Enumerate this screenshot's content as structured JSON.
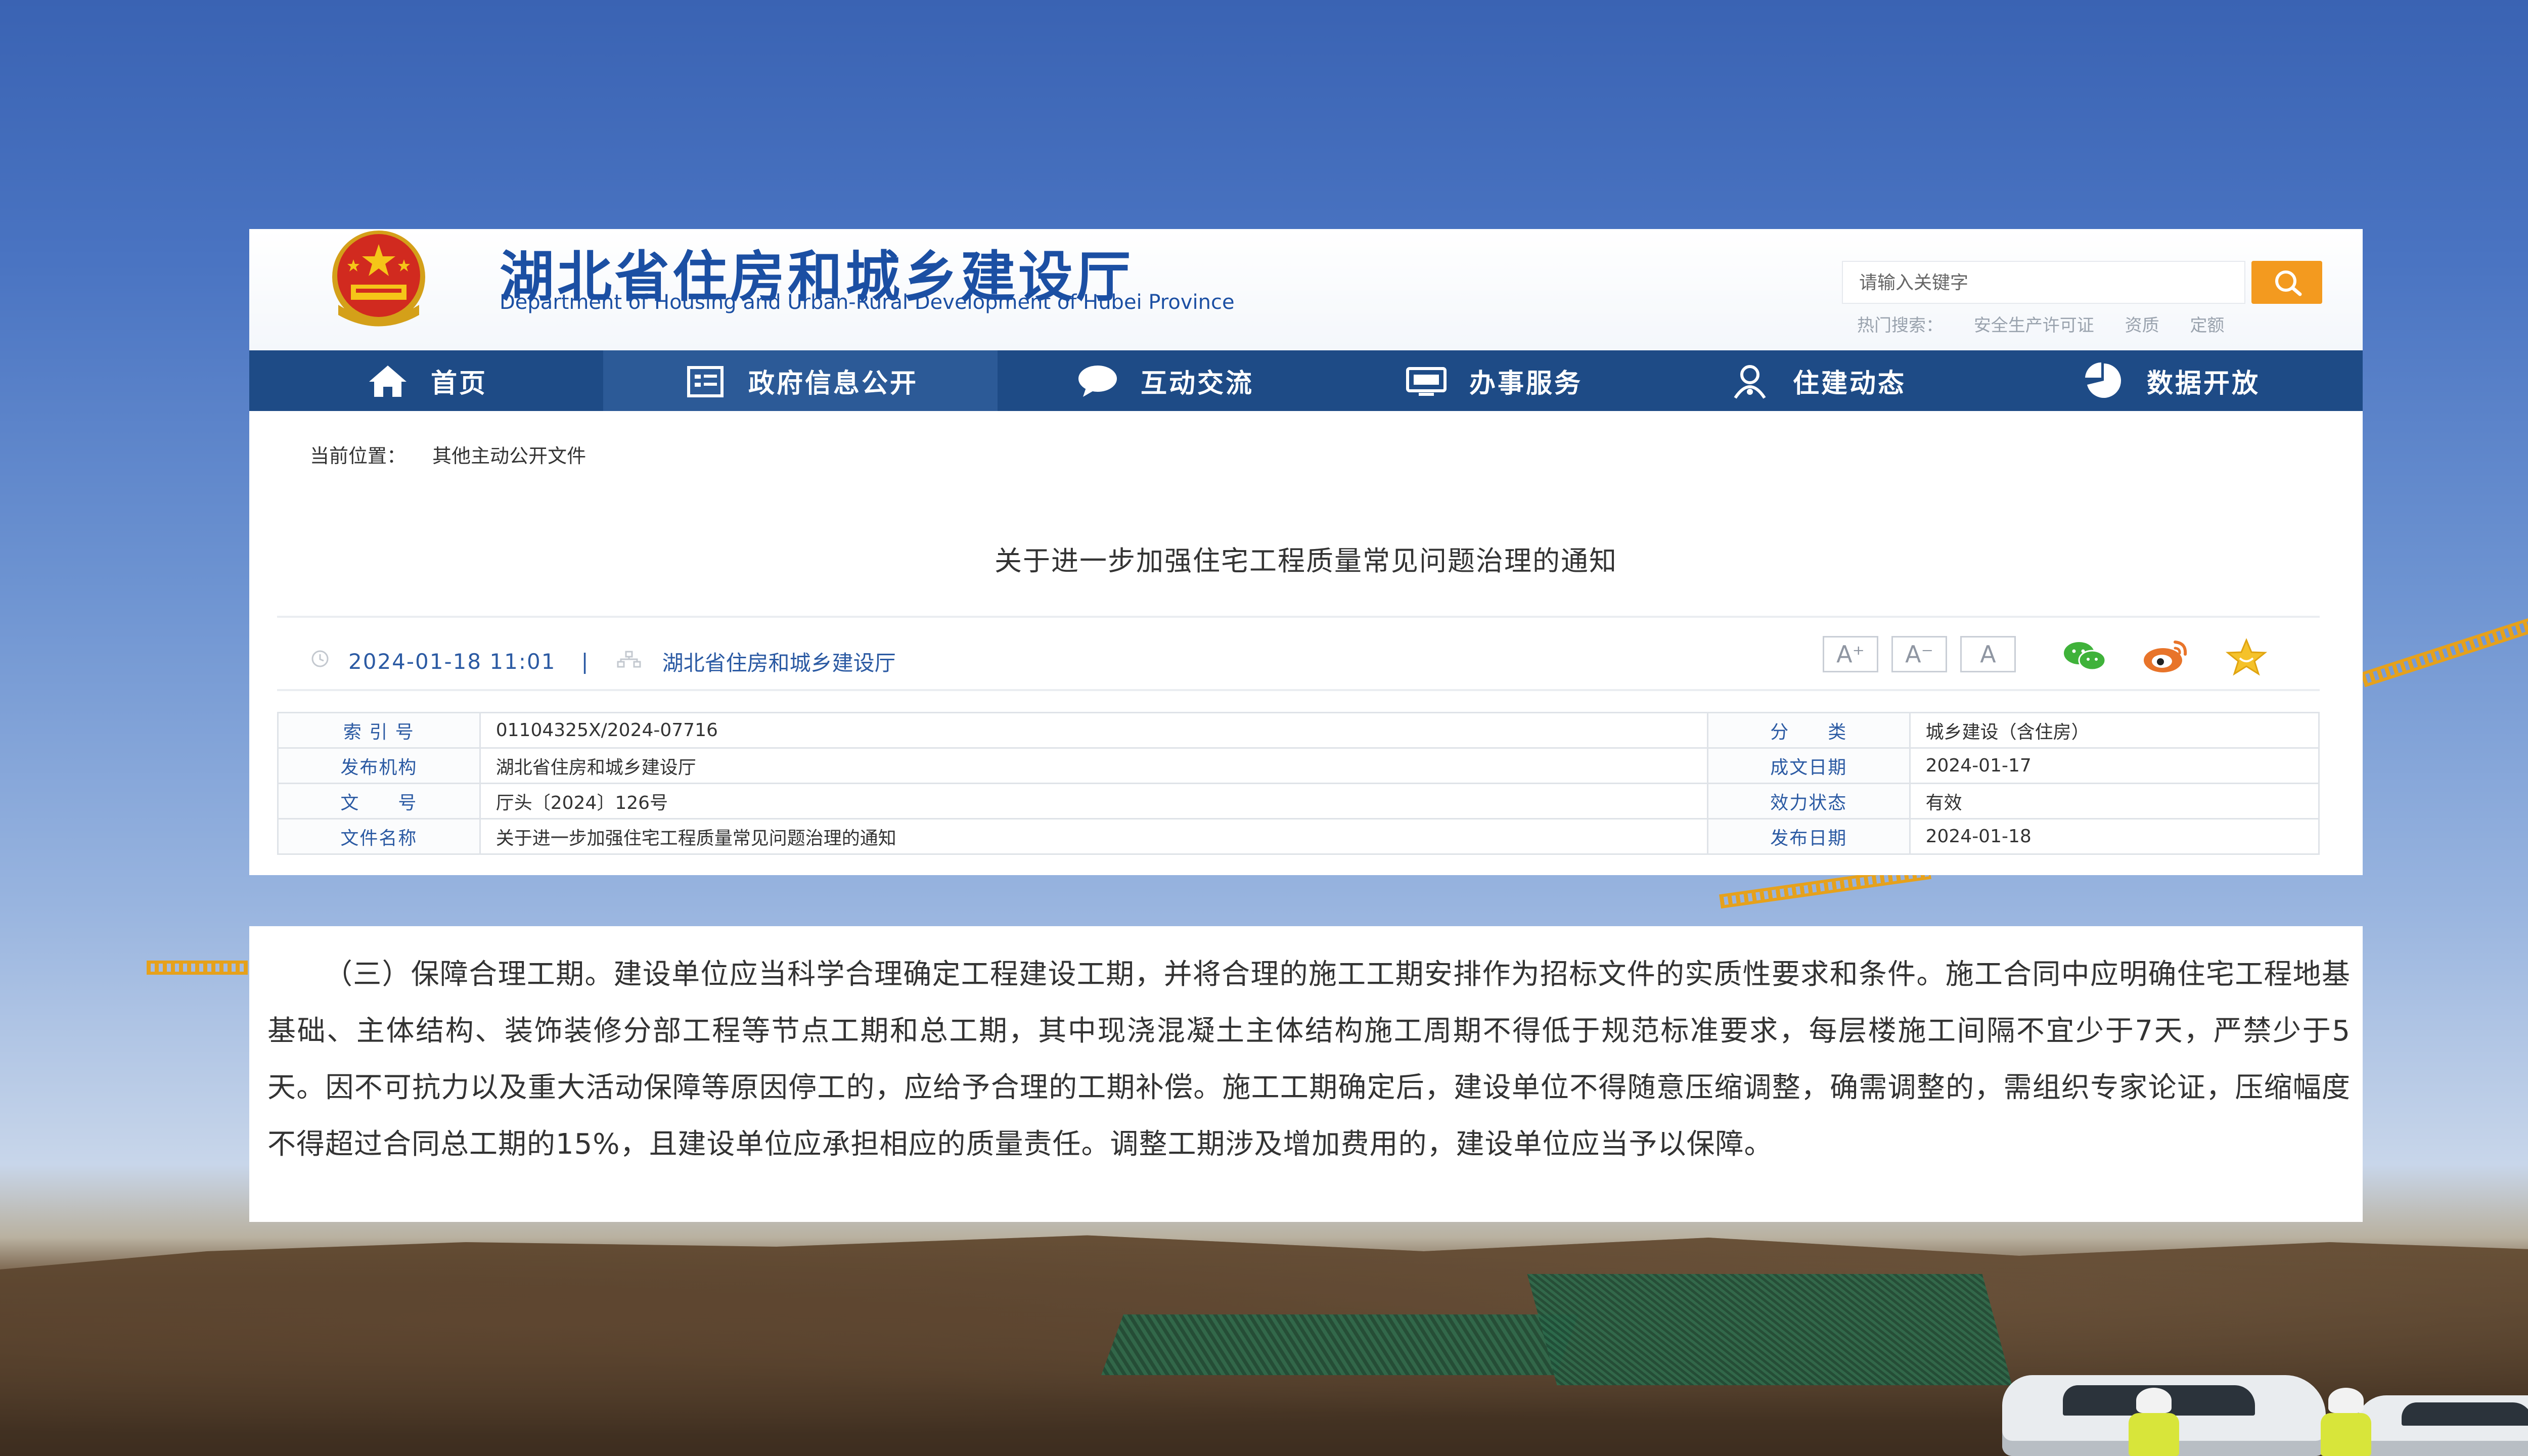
{
  "header": {
    "site_title": "湖北省住房和城乡建设厅",
    "site_subtitle": "Department of Housing and Urban-Rural Development of Hubei Province",
    "search_placeholder": "请输入关键字",
    "hot_search_label": "热门搜索：",
    "hot_search_items": [
      "安全生产许可证",
      "资质",
      "定额"
    ]
  },
  "nav": {
    "items": [
      {
        "label": "首页",
        "icon": "home-icon"
      },
      {
        "label": "政府信息公开",
        "icon": "document-list-icon",
        "active": true
      },
      {
        "label": "互动交流",
        "icon": "chat-bubble-icon"
      },
      {
        "label": "办事服务",
        "icon": "monitor-icon"
      },
      {
        "label": "住建动态",
        "icon": "user-icon"
      },
      {
        "label": "数据开放",
        "icon": "pie-chart-icon"
      }
    ]
  },
  "breadcrumb": {
    "label": "当前位置：",
    "current": "其他主动公开文件"
  },
  "article": {
    "title": "关于进一步加强住宅工程质量常见问题治理的通知",
    "date": "2024-01-18 11:01",
    "separator": "|",
    "publisher": "湖北省住房和城乡建设厅"
  },
  "font_size_buttons": [
    "A⁺",
    "A⁻",
    "A"
  ],
  "share_icons": [
    "wechat-icon",
    "weibo-icon",
    "favorite-star-icon"
  ],
  "info_table": [
    [
      {
        "label": "索 引 号",
        "value": "01104325X/2024-07716"
      },
      {
        "label": "分　　类",
        "value": "城乡建设（含住房）"
      }
    ],
    [
      {
        "label": "发布机构",
        "value": "湖北省住房和城乡建设厅"
      },
      {
        "label": "成文日期",
        "value": "2024-01-17"
      }
    ],
    [
      {
        "label": "文　　号",
        "value": "厅头〔2024〕126号"
      },
      {
        "label": "效力状态",
        "value": "有效"
      }
    ],
    [
      {
        "label": "文件名称",
        "value": "关于进一步加强住宅工程质量常见问题治理的通知"
      },
      {
        "label": "发布日期",
        "value": "2024-01-18"
      }
    ]
  ],
  "excerpt": {
    "text": "（三）保障合理工期。建设单位应当科学合理确定工程建设工期，并将合理的施工工期安排作为招标文件的实质性要求和条件。施工合同中应明确住宅工程地基基础、主体结构、装饰装修分部工程等节点工期和总工期，其中现浇混凝土主体结构施工周期不得低于规范标准要求，每层楼施工间隔不宜少于7天，严禁少于5天。因不可抗力以及重大活动保障等原因停工的，应给予合理的工期补偿。施工工期确定后，建设单位不得随意压缩调整，确需调整的，需组织专家论证，压缩幅度不得超过合同总工期的15%，且建设单位应承担相应的质量责任。调整工期涉及增加费用的，建设单位应当予以保障。"
  },
  "colors": {
    "brand_blue": "#1b4fa3",
    "nav_bg": "#1e4b86",
    "nav_active": "#2c5a97",
    "search_orange": "#f39a1f",
    "link_blue": "#2b5aa3"
  }
}
